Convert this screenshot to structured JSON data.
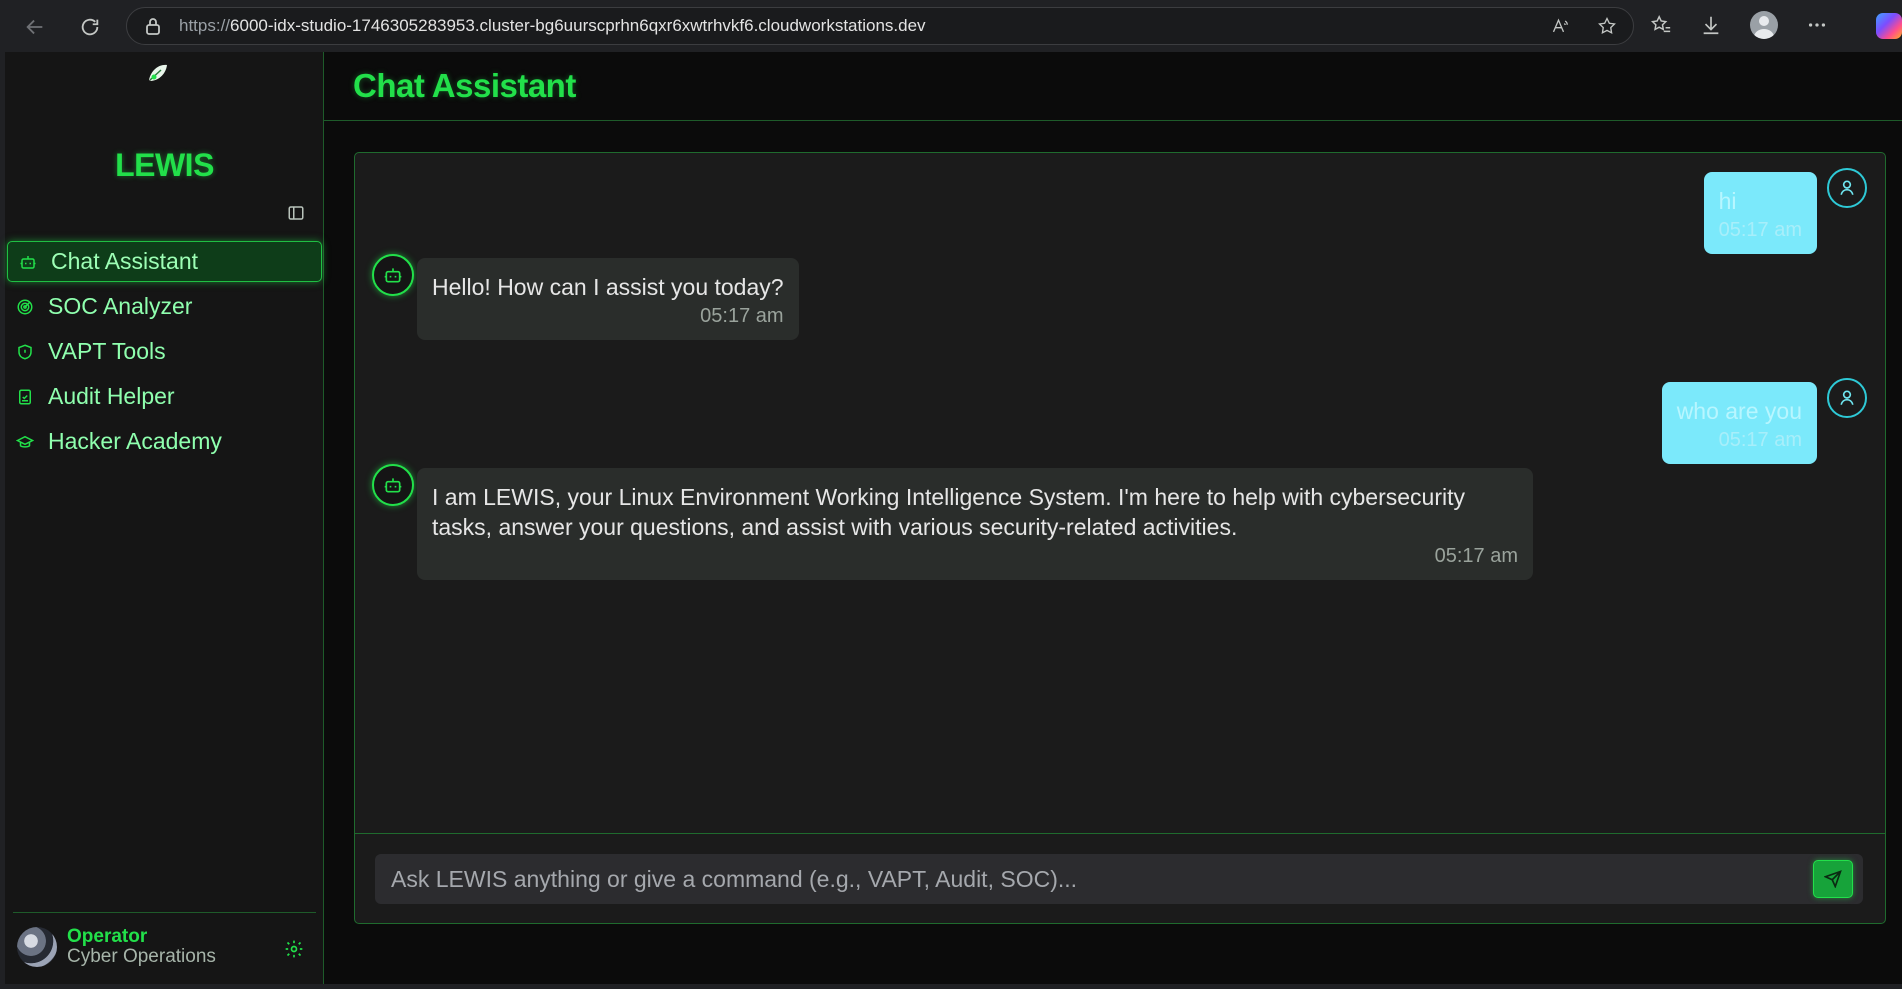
{
  "browser": {
    "url_scheme": "https://",
    "url_rest": "6000-idx-studio-1746305283953.cluster-bg6uurscprhn6qxr6xwtrhvkf6.cloudworkstations.dev"
  },
  "sidebar": {
    "brand": "LEWIS",
    "items": [
      {
        "label": "Chat Assistant",
        "icon": "bot-icon",
        "active": true
      },
      {
        "label": "SOC Analyzer",
        "icon": "radar-icon",
        "active": false
      },
      {
        "label": "VAPT Tools",
        "icon": "shield-icon",
        "active": false
      },
      {
        "label": "Audit Helper",
        "icon": "clipboard-check-icon",
        "active": false
      },
      {
        "label": "Hacker Academy",
        "icon": "graduation-cap-icon",
        "active": false
      }
    ],
    "footer": {
      "name": "Operator",
      "role": "Cyber Operations"
    }
  },
  "main": {
    "title": "Chat Assistant"
  },
  "messages": [
    {
      "sender": "user",
      "text": "hi",
      "time": "05:17 am"
    },
    {
      "sender": "bot",
      "text": "Hello! How can I assist you today?",
      "time": "05:17 am"
    },
    {
      "sender": "user",
      "text": "who are you",
      "time": "05:17 am"
    },
    {
      "sender": "bot",
      "text": "I am LEWIS, your Linux Environment Working Intelligence System. I'm here to help with cybersecurity tasks, answer your questions, and assist with various security-related activities.",
      "time": "05:17 am"
    }
  ],
  "input": {
    "placeholder": "Ask LEWIS anything or give a command (e.g., VAPT, Audit, SOC)...",
    "value": ""
  },
  "colors": {
    "accent": "#22e04a",
    "user_bubble": "#7be9fb",
    "bot_bubble": "#2a2d2b",
    "background": "#0b0b0b"
  }
}
